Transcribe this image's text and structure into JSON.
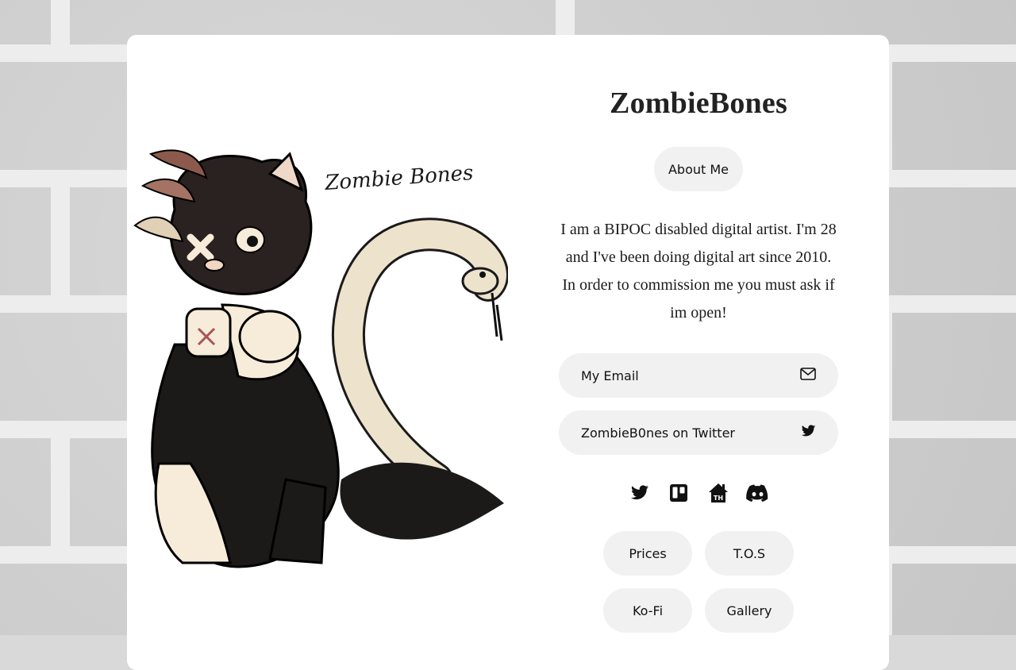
{
  "profile": {
    "name": "ZombieBones",
    "about_label": "About Me",
    "bio": "I am a BIPOC disabled digital artist. I'm 28 and I've been doing digital art since 2010. In order to commission me you must ask if im open!",
    "artwork_signature": "Zombie Bones"
  },
  "links": [
    {
      "label": "My Email",
      "icon": "mail-icon"
    },
    {
      "label": "ZombieB0nes on Twitter",
      "icon": "twitter-icon"
    }
  ],
  "social_icons": [
    "twitter-icon",
    "trello-icon",
    "toyhouse-icon",
    "discord-icon"
  ],
  "buttons": {
    "prices": "Prices",
    "tos": "T.O.S",
    "kofi": "Ko-Fi",
    "gallery": "Gallery"
  },
  "colors": {
    "card": "#ffffff",
    "pill": "#f1f1f1",
    "background": "#cfcfcf",
    "text": "#222222"
  }
}
